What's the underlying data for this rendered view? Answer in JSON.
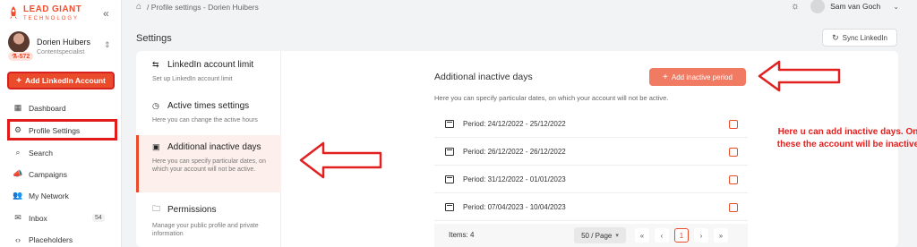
{
  "brand": {
    "title": "LEAD GIANT",
    "subtitle": "TECHNOLOGY"
  },
  "user": {
    "name": "Dorien Huibers",
    "role": "Contentspecialist",
    "badge": "⚗-572"
  },
  "sidebar": {
    "add_button": "Add LinkedIn Account",
    "items": [
      {
        "label": "Dashboard",
        "icon": "dashboard-icon"
      },
      {
        "label": "Profile Settings",
        "icon": "gear-icon"
      },
      {
        "label": "Search",
        "icon": "search-icon"
      },
      {
        "label": "Campaigns",
        "icon": "megaphone-icon"
      },
      {
        "label": "My Network",
        "icon": "people-icon"
      },
      {
        "label": "Inbox",
        "icon": "inbox-icon",
        "count": "54"
      },
      {
        "label": "Placeholders",
        "icon": "code-icon"
      }
    ]
  },
  "header": {
    "breadcrumb": "/ Profile settings - Dorien Huibers",
    "account_name": "Sam van Goch"
  },
  "page": {
    "title": "Settings",
    "sync_button": "Sync LinkedIn"
  },
  "settings_nav": [
    {
      "title": "LinkedIn account limit",
      "desc": "Set up LinkedIn account limit"
    },
    {
      "title": "Active times settings",
      "desc": "Here you can change the active hours"
    },
    {
      "title": "Additional inactive days",
      "desc": "Here you can specify particular dates, on which your account will not be active."
    },
    {
      "title": "Permissions",
      "desc": "Manage your public profile and private information"
    }
  ],
  "content": {
    "title": "Additional inactive days",
    "add_button": "Add inactive period",
    "description": "Here you can specify particular dates, on which your account will not be active.",
    "periods": [
      "Period: 24/12/2022 - 25/12/2022",
      "Period: 26/12/2022 - 26/12/2022",
      "Period: 31/12/2022 - 01/01/2023",
      "Period: 07/04/2023 - 10/04/2023"
    ],
    "footer": {
      "items": "Items: 4",
      "page_size": "50 / Page",
      "current_page": "1"
    }
  },
  "annotation": "Here u can add inactive days. On these the account will be inactive",
  "colors": {
    "accent": "#e94b2b",
    "annotation": "#e22020"
  }
}
